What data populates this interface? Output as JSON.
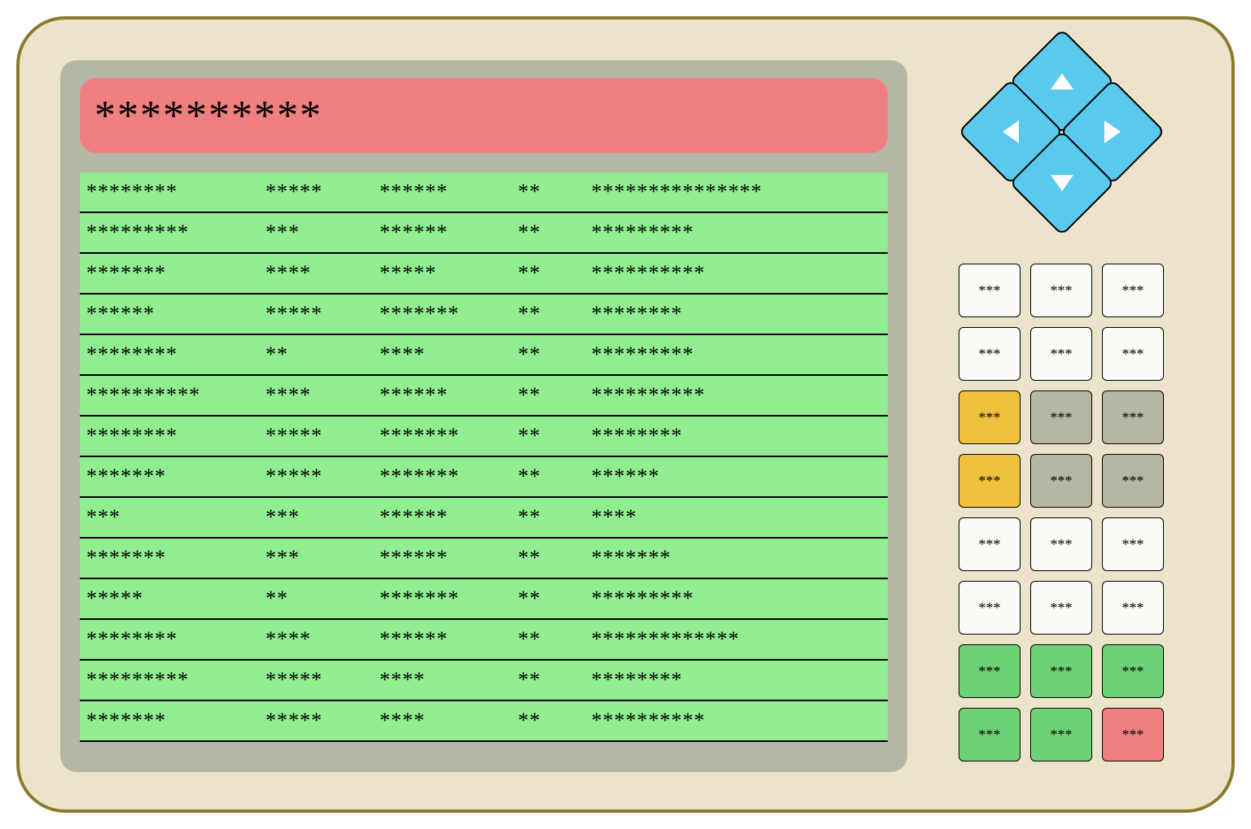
{
  "title": "**********",
  "table": {
    "rows": [
      {
        "c1": "********",
        "c2": "*****",
        "c3": "******",
        "c4": "**",
        "c5": "***************"
      },
      {
        "c1": "*********",
        "c2": "***",
        "c3": "******",
        "c4": "**",
        "c5": "*********"
      },
      {
        "c1": "*******",
        "c2": "****",
        "c3": "*****",
        "c4": "**",
        "c5": "**********"
      },
      {
        "c1": "******",
        "c2": "*****",
        "c3": "*******",
        "c4": "**",
        "c5": "********"
      },
      {
        "c1": "********",
        "c2": "**",
        "c3": "****",
        "c4": "**",
        "c5": "*********"
      },
      {
        "c1": "**********",
        "c2": "****",
        "c3": "******",
        "c4": "**",
        "c5": "**********"
      },
      {
        "c1": "********",
        "c2": "*****",
        "c3": "*******",
        "c4": "**",
        "c5": "********"
      },
      {
        "c1": "*******",
        "c2": "*****",
        "c3": "*******",
        "c4": "**",
        "c5": "******"
      },
      {
        "c1": "***",
        "c2": "***",
        "c3": "******",
        "c4": "**",
        "c5": "****"
      },
      {
        "c1": "*******",
        "c2": "***",
        "c3": "******",
        "c4": "**",
        "c5": "*******"
      },
      {
        "c1": "*****",
        "c2": "**",
        "c3": "*******",
        "c4": "**",
        "c5": "*********"
      },
      {
        "c1": "********",
        "c2": "****",
        "c3": "******",
        "c4": "**",
        "c5": "*************"
      },
      {
        "c1": "*********",
        "c2": "*****",
        "c3": "****",
        "c4": "**",
        "c5": "********"
      },
      {
        "c1": "*******",
        "c2": "*****",
        "c3": "****",
        "c4": "**",
        "c5": "**********"
      }
    ]
  },
  "keys": [
    {
      "label": "***",
      "color": "white"
    },
    {
      "label": "***",
      "color": "white"
    },
    {
      "label": "***",
      "color": "white"
    },
    {
      "label": "***",
      "color": "white"
    },
    {
      "label": "***",
      "color": "white"
    },
    {
      "label": "***",
      "color": "white"
    },
    {
      "label": "***",
      "color": "yellow"
    },
    {
      "label": "***",
      "color": "grey"
    },
    {
      "label": "***",
      "color": "grey"
    },
    {
      "label": "***",
      "color": "yellow"
    },
    {
      "label": "***",
      "color": "grey"
    },
    {
      "label": "***",
      "color": "grey"
    },
    {
      "label": "***",
      "color": "white"
    },
    {
      "label": "***",
      "color": "white"
    },
    {
      "label": "***",
      "color": "white"
    },
    {
      "label": "***",
      "color": "white"
    },
    {
      "label": "***",
      "color": "white"
    },
    {
      "label": "***",
      "color": "white"
    },
    {
      "label": "***",
      "color": "green"
    },
    {
      "label": "***",
      "color": "green"
    },
    {
      "label": "***",
      "color": "green"
    },
    {
      "label": "***",
      "color": "green"
    },
    {
      "label": "***",
      "color": "green"
    },
    {
      "label": "***",
      "color": "red"
    }
  ]
}
